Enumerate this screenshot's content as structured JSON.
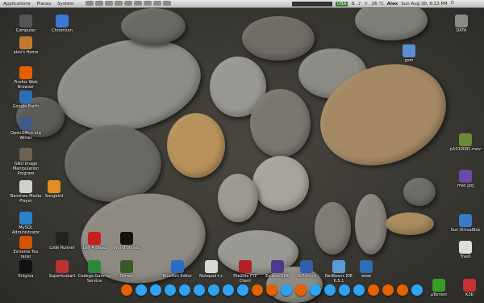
{
  "panel": {
    "menus": [
      "Applications",
      "Places",
      "System"
    ],
    "keyboard": "USA",
    "temperature": "26 °C",
    "user": "Alex",
    "clock": "Sun Aug 30,  6:13 PM"
  },
  "desktop_left": [
    {
      "label": "Computer",
      "icon": "computer-icon",
      "color": "#555"
    },
    {
      "label": "Chromium",
      "icon": "chromium-icon",
      "color": "#3c78d8"
    },
    {
      "label": "alex's Home",
      "icon": "home-icon",
      "color": "#c0792e"
    },
    {
      "label": "Firefox Web Browser",
      "icon": "firefox-icon",
      "color": "#e66000"
    },
    {
      "label": "Google Earth",
      "icon": "globe-icon",
      "color": "#2d6fb6"
    },
    {
      "label": "OpenOffice.org Writer",
      "icon": "writer-icon",
      "color": "#3f5a8a"
    },
    {
      "label": "GNU Image Manipulation Program",
      "icon": "gimp-icon",
      "color": "#6d6350"
    },
    {
      "label": "Banshee Media Player",
      "icon": "banshee-icon",
      "color": "#cfcfcf"
    },
    {
      "label": "Songbird",
      "icon": "songbird-icon",
      "color": "#e28f1f"
    },
    {
      "label": "MySQL Administrator",
      "icon": "mysql-icon",
      "color": "#2b82c9"
    },
    {
      "label": "Lode Runner",
      "icon": "lode-runner-icon",
      "color": "#222"
    },
    {
      "label": "Left 4 Dead",
      "icon": "left4dead-icon",
      "color": "#c81e1e"
    },
    {
      "label": "World of Goo",
      "icon": "world-of-goo-icon",
      "color": "#111"
    },
    {
      "label": "Extreme Tux racer",
      "icon": "tuxracer-icon",
      "color": "#d35400"
    },
    {
      "label": "Enigma",
      "icon": "enigma-icon",
      "color": "#111"
    },
    {
      "label": "Supertuxkart",
      "icon": "supertuxkart-icon",
      "color": "#b33"
    },
    {
      "label": "Cedega Gaming Service",
      "icon": "cedega-icon",
      "color": "#2a8a3a"
    },
    {
      "label": "Osmos",
      "icon": "osmos-icon",
      "color": "#3a5a2a"
    },
    {
      "label": "Bluefish Editor",
      "icon": "bluefish-icon",
      "color": "#2b6cc4"
    },
    {
      "label": "Notepad++",
      "icon": "notepad-icon",
      "color": "#d8d8d8"
    },
    {
      "label": "FileZilla FTP Client",
      "icon": "filezilla-icon",
      "color": "#b22222"
    },
    {
      "label": "Eclipse SDK",
      "icon": "eclipse-icon",
      "color": "#4b3a8c"
    },
    {
      "label": "DrPython",
      "icon": "drpython-icon",
      "color": "#2f5fa8"
    },
    {
      "label": "NetBeans IDE 6.5.1",
      "icon": "netbeans-icon",
      "color": "#5b9bd5"
    },
    {
      "label": "www",
      "icon": "www-icon",
      "color": "#2d6fb6"
    }
  ],
  "desktop_right": [
    {
      "label": "DATA",
      "icon": "drive-icon",
      "color": "#8a8a8a"
    },
    {
      "label": "gsm",
      "icon": "folder-icon",
      "color": "#5b8fd1"
    },
    {
      "label": "p1010081.mov",
      "icon": "video-icon",
      "color": "#6a8a3a"
    },
    {
      "label": "mac.jpg",
      "icon": "image-icon",
      "color": "#6a4aa8"
    },
    {
      "label": "Sun VirtualBox",
      "icon": "virtualbox-icon",
      "color": "#3a7ac8"
    },
    {
      "label": "Trash",
      "icon": "trash-icon",
      "color": "#ddd"
    },
    {
      "label": "µTorrent",
      "icon": "utorrent-icon",
      "color": "#3a9a2a"
    },
    {
      "label": "K3b",
      "icon": "k3b-icon",
      "color": "#c53030"
    }
  ],
  "dock_colors": [
    "#e66000",
    "#2ea3f2",
    "#2ea3f2",
    "#2ea3f2",
    "#2ea3f2",
    "#2ea3f2",
    "#2ea3f2",
    "#2ea3f2",
    "#2ea3f2",
    "#e66000",
    "#e66000",
    "#2ea3f2",
    "#e66000",
    "#2ea3f2",
    "#2ea3f2",
    "#2ea3f2",
    "#2ea3f2",
    "#e66000",
    "#e66000",
    "#e66000",
    "#2ea3f2"
  ]
}
